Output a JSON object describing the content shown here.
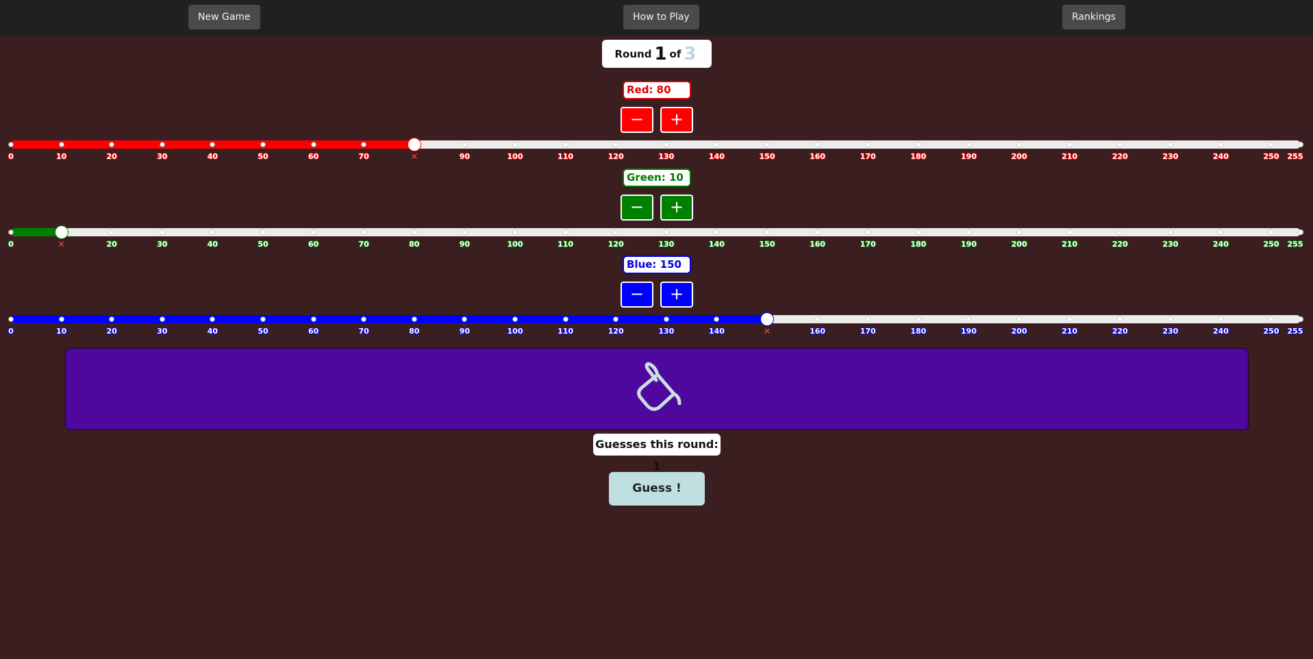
{
  "nav": {
    "new_game": "New Game",
    "how_to_play": "How to Play",
    "rankings": "Rankings"
  },
  "round": {
    "prefix": "Round",
    "current": "1",
    "of": "of",
    "total": "3"
  },
  "sliders": {
    "red": {
      "label": "Red: 80",
      "value": 80,
      "max": 255,
      "color": "#ff0000",
      "label_color": "#e00000",
      "minus": "−",
      "plus": "+"
    },
    "green": {
      "label": "Green: 10",
      "value": 10,
      "max": 255,
      "color": "#008000",
      "label_color": "#007a00",
      "minus": "−",
      "plus": "+"
    },
    "blue": {
      "label": "Blue: 150",
      "value": 150,
      "max": 255,
      "color": "#0000ff",
      "label_color": "#0000dd",
      "minus": "−",
      "plus": "+"
    }
  },
  "ticks": [
    "0",
    "10",
    "20",
    "30",
    "40",
    "50",
    "60",
    "70",
    "80",
    "90",
    "100",
    "110",
    "120",
    "130",
    "140",
    "150",
    "160",
    "170",
    "180",
    "190",
    "200",
    "210",
    "220",
    "230",
    "240",
    "250",
    "255"
  ],
  "swatch": {
    "color": "#4e089e",
    "icon": "paint-bucket-icon"
  },
  "guesses": {
    "text": "Guesses this round: 1"
  },
  "guess_button": {
    "label": "Guess !"
  }
}
